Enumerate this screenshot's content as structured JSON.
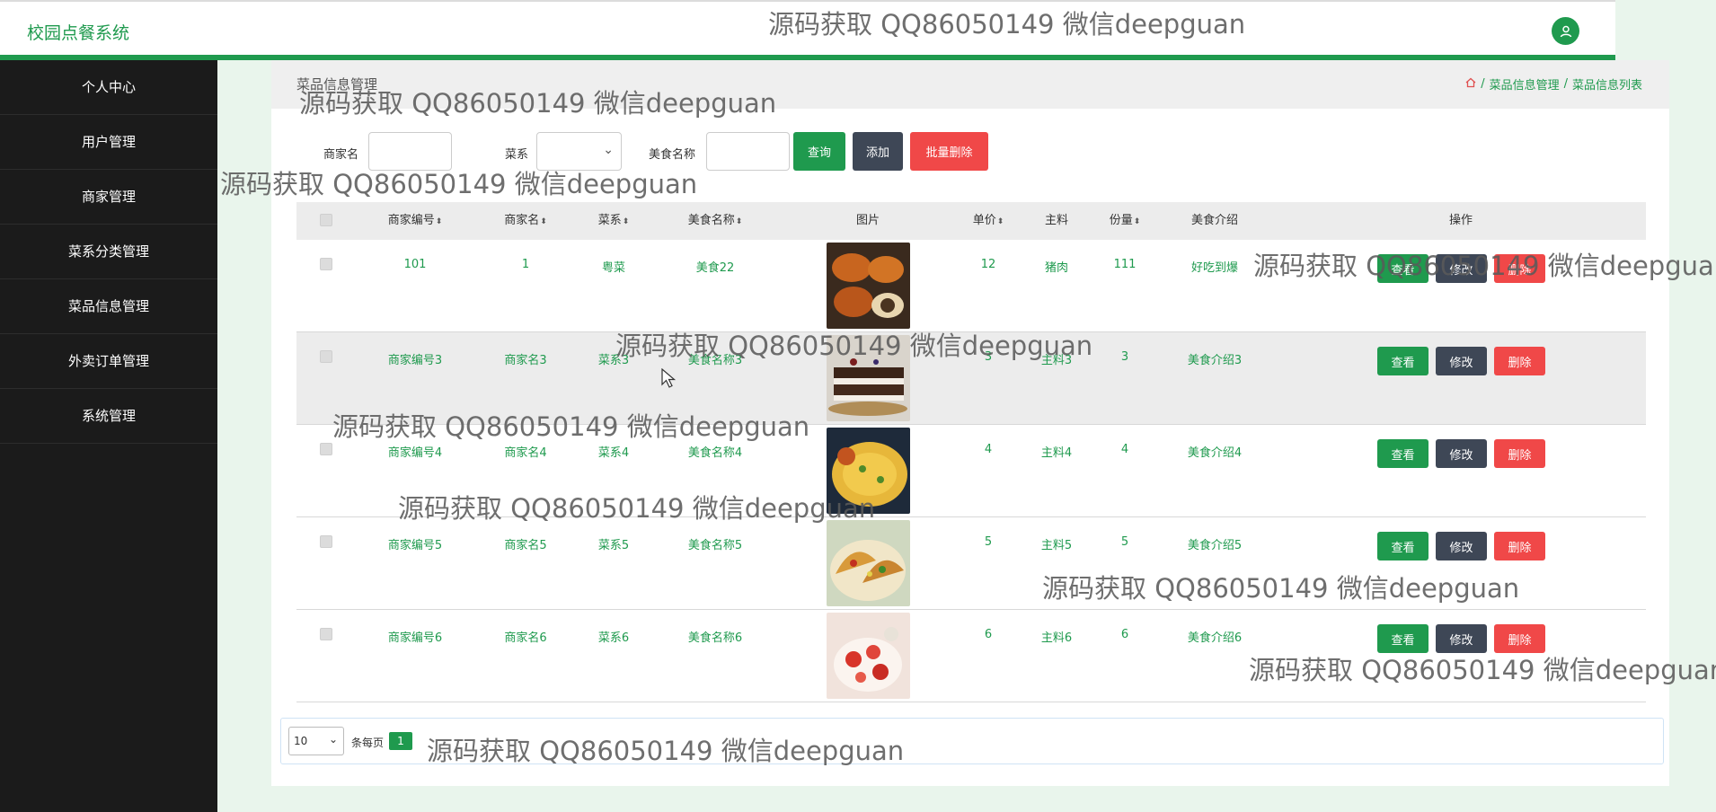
{
  "header": {
    "brand": "校园点餐系统",
    "avatar_icon": "user-icon"
  },
  "sidebar": {
    "items": [
      {
        "label": "个人中心"
      },
      {
        "label": "用户管理"
      },
      {
        "label": "商家管理"
      },
      {
        "label": "菜系分类管理"
      },
      {
        "label": "菜品信息管理"
      },
      {
        "label": "外卖订单管理"
      },
      {
        "label": "系统管理"
      }
    ]
  },
  "page": {
    "title": "菜品信息管理",
    "breadcrumb": {
      "home_icon": "home-icon",
      "sep": "/",
      "level1": "菜品信息管理",
      "level2": "菜品信息列表"
    }
  },
  "search": {
    "merchant_label": "商家名",
    "merchant_value": "",
    "cuisine_label": "菜系",
    "cuisine_value": "",
    "food_label": "美食名称",
    "food_value": "",
    "query_btn": "查询",
    "add_btn": "添加",
    "batch_delete_btn": "批量删除"
  },
  "table": {
    "columns": [
      "商家编号",
      "商家名",
      "菜系",
      "美食名称",
      "图片",
      "单价",
      "主料",
      "份量",
      "美食介绍",
      "操作"
    ],
    "sort_icon": "⬍",
    "rows": [
      {
        "merchant_no": "101",
        "merchant_name": "1",
        "cuisine": "粤菜",
        "food_name": "美食22",
        "image": "crab-dish",
        "price": "12",
        "main_ingredient": "猪肉",
        "portion": "111",
        "intro": "好吃到爆"
      },
      {
        "merchant_no": "商家编号3",
        "merchant_name": "商家名3",
        "cuisine": "菜系3",
        "food_name": "美食名称3",
        "image": "cake-slice",
        "price": "3",
        "main_ingredient": "主料3",
        "portion": "3",
        "intro": "美食介绍3"
      },
      {
        "merchant_no": "商家编号4",
        "merchant_name": "商家名4",
        "cuisine": "菜系4",
        "food_name": "美食名称4",
        "image": "omelette-dish",
        "price": "4",
        "main_ingredient": "主料4",
        "portion": "4",
        "intro": "美食介绍4"
      },
      {
        "merchant_no": "商家编号5",
        "merchant_name": "商家名5",
        "cuisine": "菜系5",
        "food_name": "美食名称5",
        "image": "tacos-plate",
        "price": "5",
        "main_ingredient": "主料5",
        "portion": "5",
        "intro": "美食介绍5"
      },
      {
        "merchant_no": "商家编号6",
        "merchant_name": "商家名6",
        "cuisine": "菜系6",
        "food_name": "美食名称6",
        "image": "strawberry-dessert",
        "price": "6",
        "main_ingredient": "主料6",
        "portion": "6",
        "intro": "美食介绍6"
      }
    ],
    "actions": {
      "view": "查看",
      "edit": "修改",
      "delete": "删除"
    }
  },
  "pagination": {
    "page_size": "10",
    "per_page_label": "条每页",
    "current_page": "1"
  },
  "watermark": "源码获取 QQ86050149 微信deepguan",
  "colors": {
    "accent": "#1f9a4e",
    "sidebar": "#1b1b1b",
    "dark_btn": "#3e4756",
    "danger": "#f04848"
  }
}
